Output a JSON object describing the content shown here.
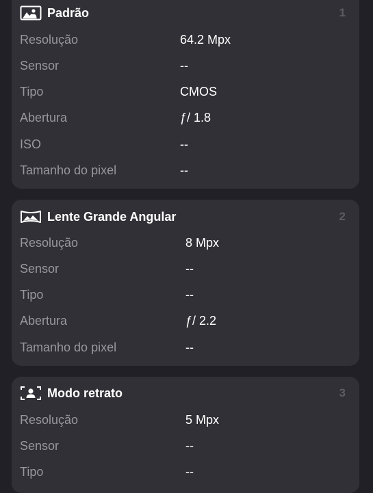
{
  "cameras": [
    {
      "title": "Padrão",
      "index": "1",
      "icon": "standard-camera-icon",
      "specs": [
        {
          "label": "Resolução",
          "value": "64.2 Mpx"
        },
        {
          "label": "Sensor",
          "value": "--"
        },
        {
          "label": "Tipo",
          "value": "CMOS"
        },
        {
          "label": "Abertura",
          "value": "ƒ/ 1.8"
        },
        {
          "label": "ISO",
          "value": "--"
        },
        {
          "label": "Tamanho do pixel",
          "value": "--"
        }
      ]
    },
    {
      "title": "Lente Grande Angular",
      "index": "2",
      "icon": "wide-angle-lens-icon",
      "specs": [
        {
          "label": "Resolução",
          "value": "8 Mpx"
        },
        {
          "label": "Sensor",
          "value": "--"
        },
        {
          "label": "Tipo",
          "value": "--"
        },
        {
          "label": "Abertura",
          "value": "ƒ/ 2.2"
        },
        {
          "label": "Tamanho do pixel",
          "value": "--"
        }
      ]
    },
    {
      "title": "Modo retrato",
      "index": "3",
      "icon": "portrait-mode-icon",
      "specs": [
        {
          "label": "Resolução",
          "value": "5 Mpx"
        },
        {
          "label": "Sensor",
          "value": "--"
        },
        {
          "label": "Tipo",
          "value": "--"
        }
      ]
    }
  ],
  "colors": {
    "background": "#212026",
    "card": "#313036",
    "label": "#98979d",
    "value": "#ffffff",
    "index": "#5d5c62"
  }
}
